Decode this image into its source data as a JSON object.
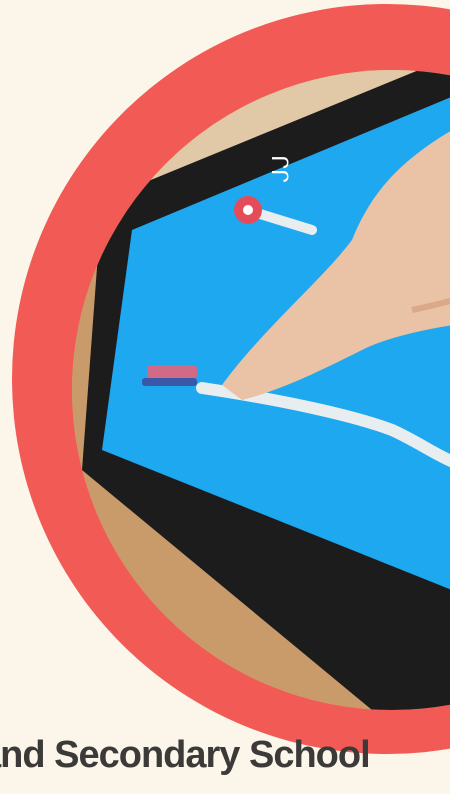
{
  "caption": {
    "text": "and Secondary School"
  },
  "colors": {
    "background": "#fbf5ea",
    "ring": "#f25a55",
    "caption_text": "#3b3a38",
    "screen": "#1ea8f0"
  },
  "photo": {
    "subject": "tablet-with-finger-tracing-path"
  }
}
